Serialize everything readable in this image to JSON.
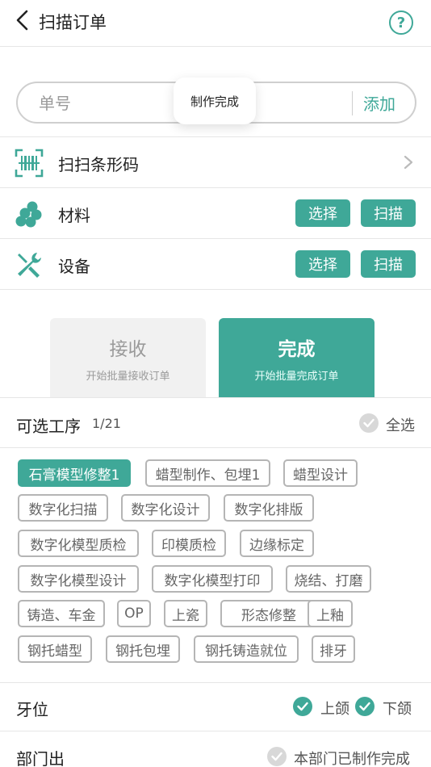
{
  "header": {
    "title": "扫描订单",
    "help_glyph": "?"
  },
  "order": {
    "placeholder": "单号",
    "add_label": "添加",
    "toast": "制作完成"
  },
  "rows": {
    "barcode": {
      "label": "扫扫条形码",
      "icon": "barcode-scan-icon"
    },
    "material": {
      "label": "材料",
      "icon": "material-cells-icon",
      "select_label": "选择",
      "scan_label": "扫描"
    },
    "equipment": {
      "label": "设备",
      "icon": "tools-icon",
      "select_label": "选择",
      "scan_label": "扫描"
    }
  },
  "modes": [
    {
      "title": "接收",
      "subtitle": "开始批量接收订单",
      "active": false
    },
    {
      "title": "完成",
      "subtitle": "开始批量完成订单",
      "active": true
    }
  ],
  "processes": {
    "title": "可选工序",
    "count": "1/21",
    "select_all_label": "全选",
    "tags": [
      {
        "label": "石膏模型修整1",
        "active": true
      },
      {
        "label": "蜡型制作、包埋1",
        "active": false
      },
      {
        "label": "蜡型设计",
        "active": false
      },
      {
        "label": "数字化扫描",
        "active": false
      },
      {
        "label": "数字化设计",
        "active": false
      },
      {
        "label": "数字化排版",
        "active": false
      },
      {
        "label": "数字化模型质检",
        "active": false
      },
      {
        "label": "印模质检",
        "active": false
      },
      {
        "label": "边缘标定",
        "active": false
      },
      {
        "label": "数字化模型设计",
        "active": false
      },
      {
        "label": "数字化模型打印",
        "active": false
      },
      {
        "label": "烧结、打磨",
        "active": false
      },
      {
        "label": "铸造、车金",
        "active": false
      },
      {
        "label": "OP",
        "active": false
      },
      {
        "label": "上瓷",
        "active": false
      },
      {
        "label": "形态修整",
        "active": false
      },
      {
        "label": "上釉",
        "active": false
      },
      {
        "label": "钢托蜡型",
        "active": false
      },
      {
        "label": "钢托包埋",
        "active": false
      },
      {
        "label": "钢托铸造就位",
        "active": false
      },
      {
        "label": "排牙",
        "active": false
      }
    ]
  },
  "tooth": {
    "label": "牙位",
    "upper_label": "上颌",
    "lower_label": "下颌",
    "upper_checked": true,
    "lower_checked": true
  },
  "dept": {
    "label": "部门出",
    "option_label": "本部门已制作完成",
    "checked": false
  },
  "colors": {
    "accent": "#3fa898",
    "border": "#e6e6e6",
    "tag_border": "#b5b5b5",
    "inactive_check": "#d8d8d8"
  }
}
